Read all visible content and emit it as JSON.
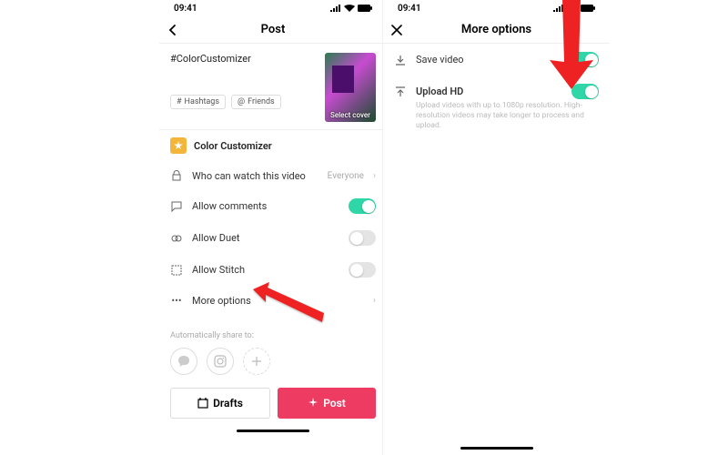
{
  "status": {
    "time": "09:41"
  },
  "left": {
    "title": "Post",
    "caption": "#ColorCustomizer",
    "hashtags_chip": "Hashtags",
    "friends_chip": "Friends",
    "cover_label": "Select cover",
    "effect_name": "Color Customizer",
    "rows": {
      "privacy": {
        "label": "Who can watch this video",
        "value": "Everyone"
      },
      "comments": {
        "label": "Allow comments"
      },
      "duet": {
        "label": "Allow Duet"
      },
      "stitch": {
        "label": "Allow Stitch"
      },
      "more": {
        "label": "More options"
      }
    },
    "share_label": "Automatically share to:",
    "drafts_btn": "Drafts",
    "post_btn": "Post"
  },
  "right": {
    "title": "More options",
    "save_video": "Save video",
    "upload_hd": "Upload HD",
    "upload_hd_desc": "Upload videos with up to 1080p resolution. High-resolution videos may take longer to process and upload."
  },
  "colors": {
    "accent": "#2fd6a8",
    "primary": "#ee3b62"
  }
}
